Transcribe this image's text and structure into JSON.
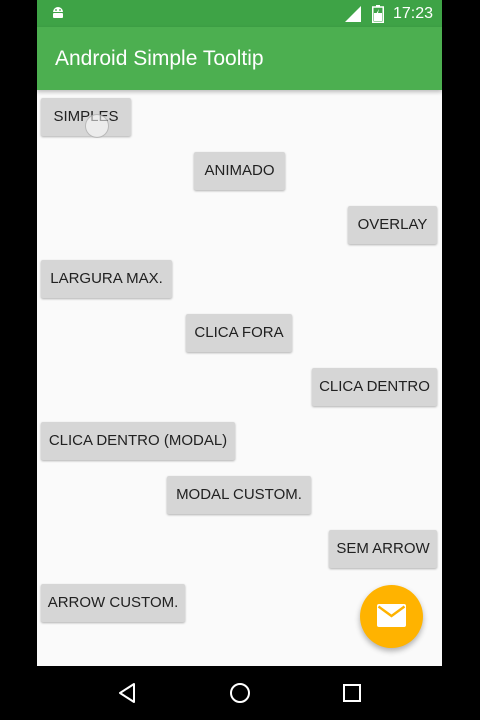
{
  "status_bar": {
    "time": "17:23",
    "icons": [
      "android-notification-icon",
      "signal-icon",
      "battery-charging-icon"
    ]
  },
  "app_bar": {
    "title": "Android Simple Tooltip"
  },
  "buttons": [
    {
      "id": "simples",
      "label": "SIMPLES"
    },
    {
      "id": "animado",
      "label": "ANIMADO"
    },
    {
      "id": "overlay",
      "label": "OVERLAY"
    },
    {
      "id": "largura-max",
      "label": "LARGURA MAX."
    },
    {
      "id": "clica-fora",
      "label": "CLICA FORA"
    },
    {
      "id": "clica-dentro",
      "label": "CLICA DENTRO"
    },
    {
      "id": "clica-dentro-modal",
      "label": "CLICA DENTRO (MODAL)"
    },
    {
      "id": "modal-custom",
      "label": "MODAL CUSTOM."
    },
    {
      "id": "sem-arrow",
      "label": "SEM ARROW"
    },
    {
      "id": "arrow-custom",
      "label": "ARROW CUSTOM."
    }
  ],
  "fab": {
    "icon": "email-icon"
  },
  "nav_bar": {
    "icons": [
      "back-icon",
      "home-icon",
      "recents-icon"
    ]
  },
  "colors": {
    "primary": "#4caf50",
    "primary_dark": "#3ea346",
    "accent": "#ffb300"
  }
}
